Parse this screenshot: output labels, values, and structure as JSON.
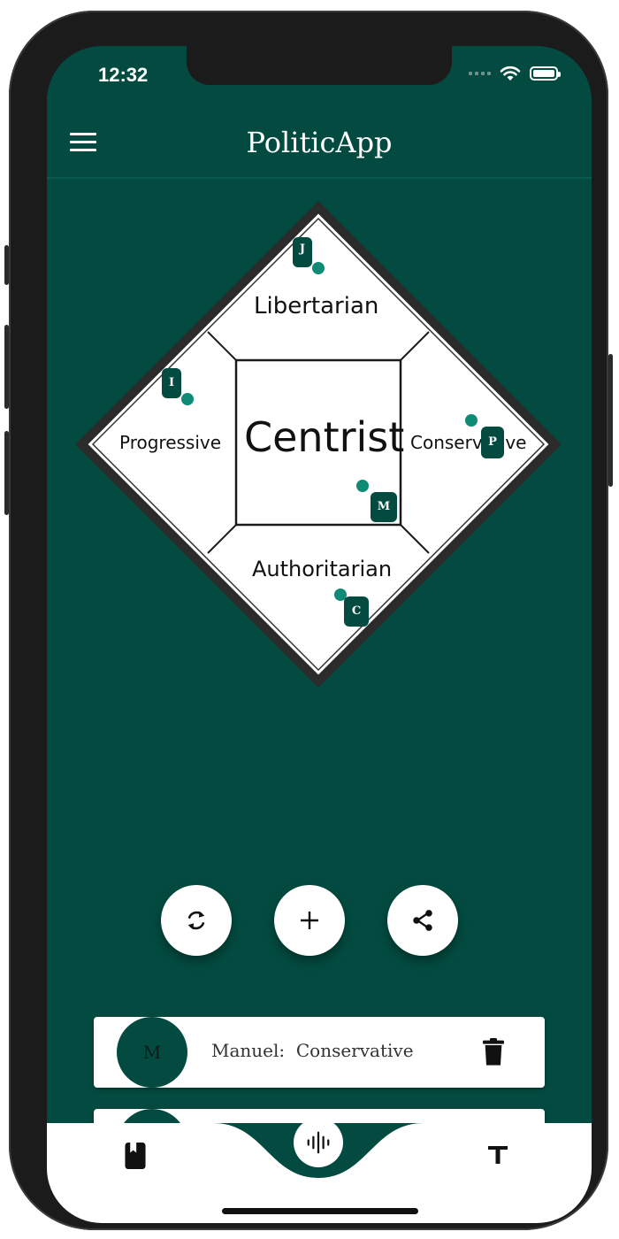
{
  "status_bar": {
    "time": "12:32"
  },
  "header": {
    "title": "PoliticApp"
  },
  "compass": {
    "labels": {
      "top": "Libertarian",
      "left": "Progressive",
      "center": "Centrist",
      "right": "Conservative",
      "bottom": "Authoritarian"
    },
    "markers": [
      {
        "initial": "J"
      },
      {
        "initial": "I"
      },
      {
        "initial": "P"
      },
      {
        "initial": "M"
      },
      {
        "initial": "C"
      }
    ]
  },
  "actions": {
    "refresh_icon": "refresh-icon",
    "add_icon": "plus-icon",
    "share_icon": "share-icon"
  },
  "people": [
    {
      "initial": "M",
      "text": "Manuel:  Conservative"
    },
    {
      "initial": "",
      "text": ""
    }
  ],
  "bottom_nav": {
    "left_icon": "book-icon",
    "center_icon": "audio-wave-icon",
    "right_icon": "text-icon"
  },
  "colors": {
    "background": "#034b40",
    "accent_dot": "#0f8a76",
    "card": "#ffffff",
    "frame": "#1b1b1b"
  }
}
